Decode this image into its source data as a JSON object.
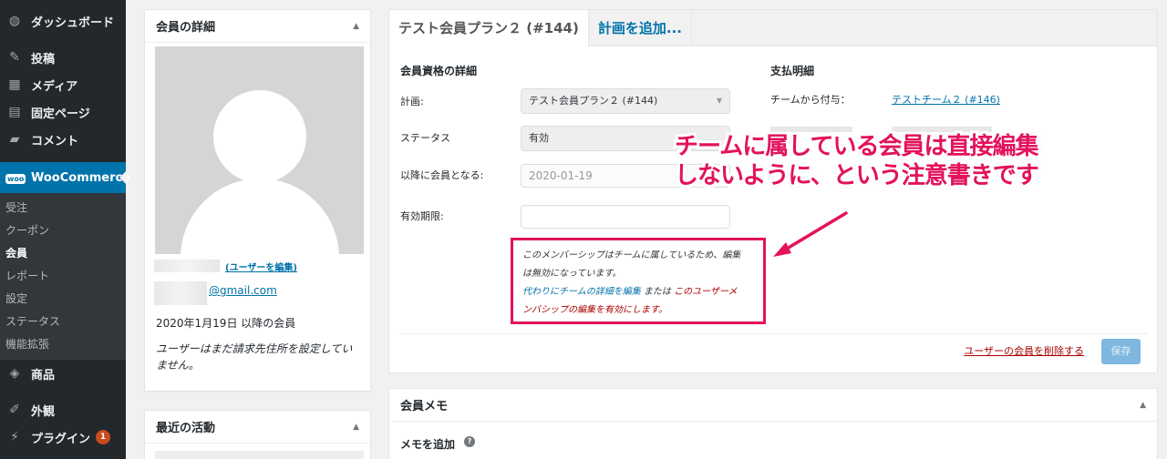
{
  "sidebar": {
    "items": [
      {
        "label": "ダッシュボード",
        "icon": "dashboard-icon",
        "glyph": "◍"
      },
      {
        "label": "投稿",
        "icon": "pin-icon",
        "glyph": "✎"
      },
      {
        "label": "メディア",
        "icon": "media-icon",
        "glyph": "▦"
      },
      {
        "label": "固定ページ",
        "icon": "page-icon",
        "glyph": "▤"
      },
      {
        "label": "コメント",
        "icon": "comment-icon",
        "glyph": "▰"
      }
    ],
    "current": {
      "label": "WooCommerce",
      "badge": "woo"
    },
    "submenu": [
      "受注",
      "クーポン",
      "会員",
      "レポート",
      "設定",
      "ステータス",
      "機能拡張"
    ],
    "submenu_active_index": 2,
    "bottom_items": [
      {
        "label": "商品",
        "icon": "box-icon",
        "glyph": "◈"
      },
      {
        "label": "外観",
        "icon": "brush-icon",
        "glyph": "✐"
      },
      {
        "label": "プラグイン",
        "icon": "plugin-icon",
        "glyph": "⚡",
        "count": "1"
      }
    ]
  },
  "member_details": {
    "title": "会員の詳細",
    "edit_user_link": "(ユーザーを編集)",
    "email": "@gmail.com",
    "member_since": "2020年1月19日 以降の会員",
    "no_billing": "ユーザーはまだ請求先住所を設定していません。"
  },
  "recent_activity": {
    "title": "最近の活動"
  },
  "plan_panel": {
    "tab_active": "テスト会員プラン２ (#144)",
    "tab_add": "計画を追加...",
    "membership_section": "会員資格の詳細",
    "billing_section": "支払明細",
    "plan_label": "計画:",
    "plan_value": "テスト会員プラン２ (#144)",
    "status_label": "ステータス",
    "status_value": "有効",
    "member_from_label": "以降に会員となる:",
    "member_from_value": "2020-01-19",
    "expiry_label": "有効期限:",
    "expiry_value": "",
    "granted_by_label": "チームから付与：",
    "granted_by_value": "テストチーム２ (#146)",
    "notice_line1": "このメンバーシップはチームに属しているため、編集",
    "notice_line2": "は無効になっています。",
    "notice_edit_team": "代わりにチームの詳細を編集",
    "notice_or": "または",
    "notice_enable_1": "このユーザーメ",
    "notice_enable_2": "ンバシップの編集を有効にします。",
    "delete_link": "ユーザーの会員を削除する",
    "save_button": "保存"
  },
  "notes_panel": {
    "title": "会員メモ",
    "add_note": "メモを追加",
    "help": "?"
  },
  "annotation": {
    "line1": "チームに属している会員は直接編集",
    "line2": "しないように、という注意書きです",
    "color": "#e3125c"
  },
  "colors": {
    "sidebar_bg": "#23282d",
    "accent": "#0073aa",
    "danger": "#aa0000",
    "annotation": "#e3125c"
  }
}
